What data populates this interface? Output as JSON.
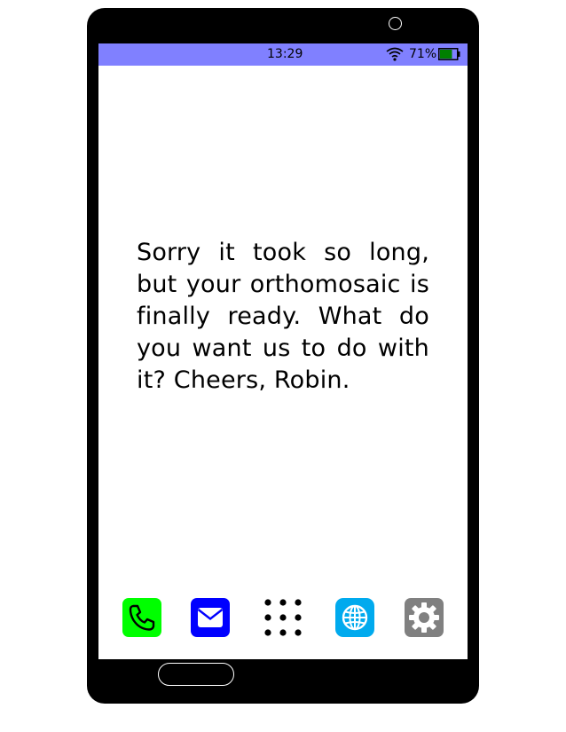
{
  "status_bar": {
    "time": "13:29",
    "battery_percent": "71%",
    "battery_level": 0.71,
    "background_color": "#8080ff"
  },
  "message": {
    "text": "Sorry it took so long, but your orthomosaic is finally ready.  What do you want us to do with it?  Cheers, Robin."
  },
  "dock": {
    "icons": [
      {
        "name": "phone-icon",
        "color": "#00ff00"
      },
      {
        "name": "mail-icon",
        "color": "#0000ff"
      },
      {
        "name": "apps-grid-icon",
        "color": "#000000"
      },
      {
        "name": "browser-globe-icon",
        "color": "#00aaee"
      },
      {
        "name": "settings-gear-icon",
        "color": "#808080"
      }
    ]
  }
}
